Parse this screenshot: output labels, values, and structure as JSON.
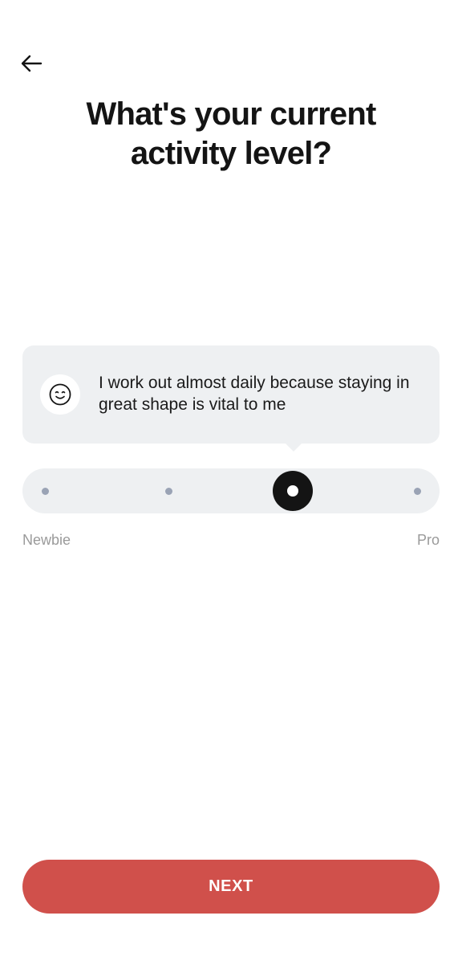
{
  "header": {
    "back_icon": "arrow-left-icon",
    "title": "What's your current activity level?"
  },
  "tooltip": {
    "icon": "smiling-face-icon",
    "text": "I work out almost daily because staying in great shape is vital to me"
  },
  "slider": {
    "steps": 4,
    "selected_step": 3,
    "min_label": "Newbie",
    "max_label": "Pro"
  },
  "footer": {
    "next_label": "NEXT"
  },
  "colors": {
    "accent": "#d0504b",
    "thumb": "#141414",
    "track": "#eef0f2",
    "dot": "#9aa3b5"
  }
}
